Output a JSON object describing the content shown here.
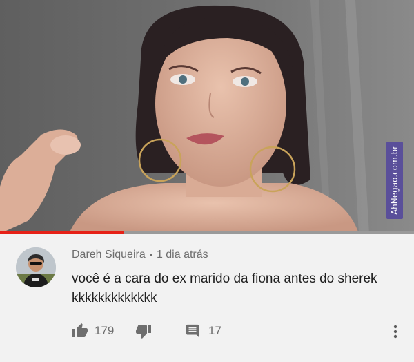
{
  "watermark": {
    "text": "AhNegao.com.br"
  },
  "video": {
    "progress_fraction": 0.3
  },
  "comment": {
    "author": "Dareh Siqueira",
    "separator": "•",
    "time": "1 dia atrás",
    "text": "você é a cara do ex marido da fiona antes do sherek kkkkkkkkkkkkk",
    "likes": "179",
    "replies": "17"
  },
  "icons": {
    "like": "thumbs-up-icon",
    "dislike": "thumbs-down-icon",
    "reply": "comment-icon",
    "more": "more-vertical-icon"
  },
  "colors": {
    "progress": "#e62117",
    "watermark_bg": "#5a4f9a"
  }
}
